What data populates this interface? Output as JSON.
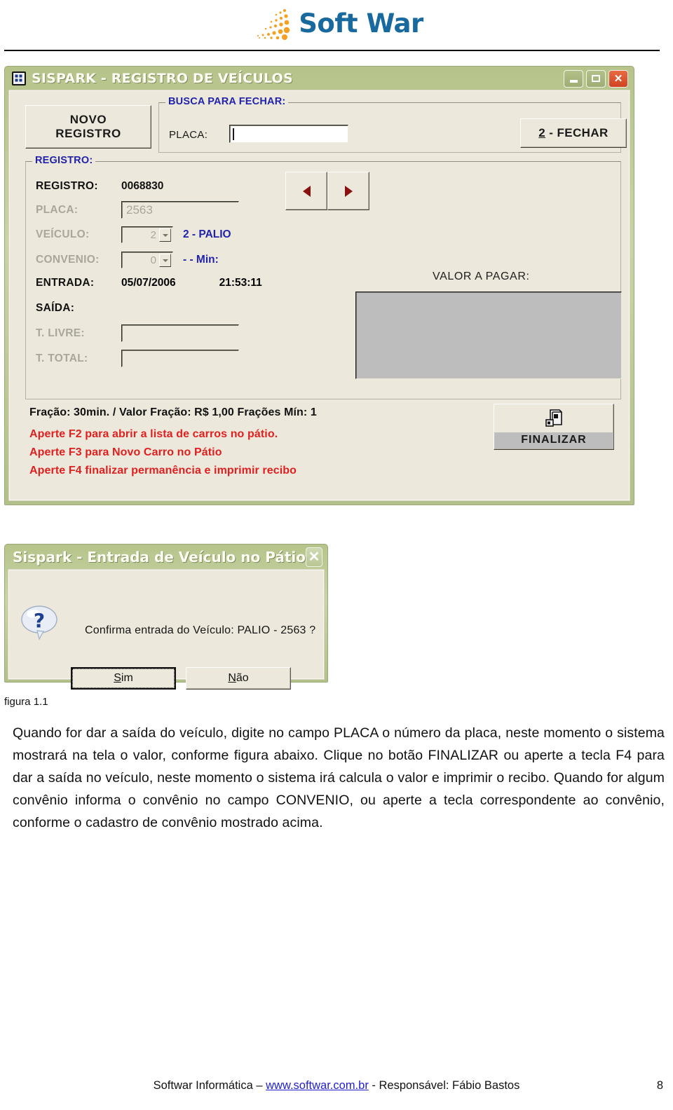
{
  "logo": {
    "text": "Soft War",
    "dots_icon": "orange-dot-swoosh-icon",
    "color": "#17699e",
    "accent": "#f5a020"
  },
  "main_window": {
    "icon": "grid-form-icon",
    "title": "SISPARK - REGISTRO DE VEÍCULOS",
    "controls": {
      "minimize": "minimize-icon",
      "maximize": "maximize-icon",
      "close": "✕"
    },
    "titlebar_color": "#b6c48b",
    "toolbar": {
      "novo_registro": "NOVO\nREGISTRO",
      "novo_registro_line1": "NOVO",
      "novo_registro_line2": "REGISTRO",
      "fechar": "2 - FECHAR",
      "fechar_accel": "2",
      "fechar_rest": " - FECHAR"
    },
    "busca_group": {
      "legend": "BUSCA PARA FECHAR:",
      "placa_label": "PLACA:",
      "placa_value": "",
      "placa_placeholder": ""
    },
    "registro_group": {
      "legend": "REGISTRO:",
      "fields": {
        "registro_label": "REGISTRO:",
        "registro_value": "0068830",
        "placa_label": "PLACA:",
        "placa_value": "2563",
        "veiculo_label": "VEÍCULO:",
        "veiculo_combo_value": "2",
        "veiculo_desc": "2 - PALIO",
        "convenio_label": "CONVENIO:",
        "convenio_combo_value": "0",
        "convenio_desc": "-  - Min:",
        "entrada_label": "ENTRADA:",
        "entrada_date": "05/07/2006",
        "entrada_time": "21:53:11",
        "saida_label": "SAÍDA:",
        "t_livre_label": "T. LIVRE:",
        "t_livre_value": "",
        "t_total_label": "T. TOTAL:",
        "t_total_value": ""
      },
      "nav": {
        "prev_icon": "arrow-left-icon",
        "next_icon": "arrow-right-icon",
        "arrow_color": "#8b1010"
      },
      "valor_label": "VALOR A PAGAR:",
      "valor_value": ""
    },
    "status": {
      "fracao": "Fração: 30min. / Valor Fração: R$ 1,00 Frações Mín: 1",
      "hint1": "Aperte F2 para abrir a lista de carros no pátio.",
      "hint2": "Aperte F3 para Novo Carro no Pátio",
      "hint3": "Aperte F4 finalizar permanência e imprimir recibo",
      "hint_color": "#e02020"
    },
    "finalizar": {
      "label": "FINALIZAR",
      "icon": "printer-books-icon"
    }
  },
  "dialog": {
    "title": "Sispark - Entrada de Veículo no Pátio",
    "close_glyph": "✕",
    "icon": "question-balloon-icon",
    "message": "Confirma entrada do Veículo: PALIO - 2563 ?",
    "buttons": {
      "yes": "Sim",
      "yes_accel": "S",
      "no": "Não",
      "no_accel": "N"
    }
  },
  "document": {
    "figure_caption": "figura 1.1",
    "paragraph": "Quando for dar a saída do veículo, digite no campo PLACA o número da placa, neste momento o sistema mostrará na tela o valor, conforme figura abaixo. Clique no botão FINALIZAR ou aperte a tecla F4 para dar a saída no veículo, neste momento o sistema irá calcula o valor e imprimir o recibo. Quando for algum convênio informa o convênio no campo CONVENIO, ou aperte a tecla correspondente ao convênio, conforme o cadastro de convênio mostrado acima.",
    "footer_prefix": "Softwar Informática – ",
    "footer_link": "www.softwar.com.br",
    "footer_suffix": " - Responsável: Fábio Bastos",
    "page_number": "8"
  }
}
